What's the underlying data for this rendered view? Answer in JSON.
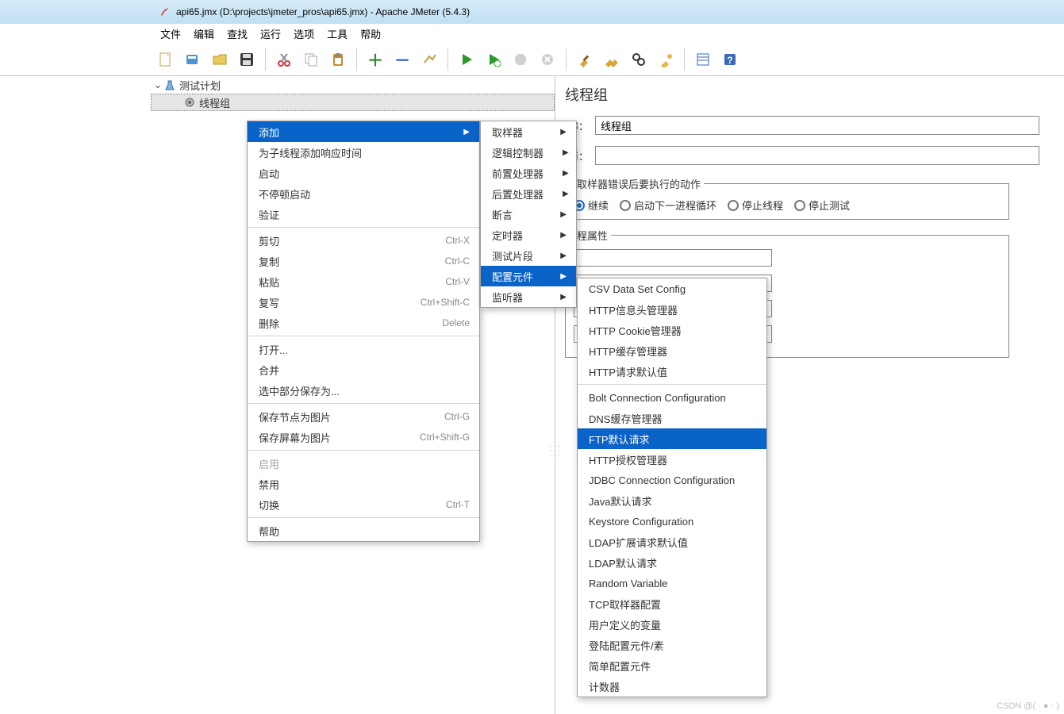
{
  "title": "api65.jmx (D:\\projects\\jmeter_pros\\api65.jmx) - Apache JMeter (5.4.3)",
  "menubar": [
    "文件",
    "编辑",
    "查找",
    "运行",
    "选项",
    "工具",
    "帮助"
  ],
  "tree": {
    "root_label": "测试计划",
    "child_label": "线程组"
  },
  "panel": {
    "heading": "线程组",
    "name_label": "称：",
    "name_value": "线程组",
    "comment_label": "释：",
    "error_legend": "取样器错误后要执行的动作",
    "props_legend": "程属性",
    "radios": [
      "继续",
      "启动下一进程循环",
      "停止线程",
      "停止测试"
    ],
    "radio_selected": 0
  },
  "menu1": [
    {
      "label": "添加",
      "hl": true,
      "arrow": true
    },
    {
      "label": "为子线程添加响应时间"
    },
    {
      "label": "启动"
    },
    {
      "label": "不停顿启动"
    },
    {
      "label": "验证"
    },
    {
      "sep": true
    },
    {
      "label": "剪切",
      "short": "Ctrl-X"
    },
    {
      "label": "复制",
      "short": "Ctrl-C"
    },
    {
      "label": "粘贴",
      "short": "Ctrl-V"
    },
    {
      "label": "复写",
      "short": "Ctrl+Shift-C"
    },
    {
      "label": "删除",
      "short": "Delete"
    },
    {
      "sep": true
    },
    {
      "label": "打开..."
    },
    {
      "label": "合并"
    },
    {
      "label": "选中部分保存为..."
    },
    {
      "sep": true
    },
    {
      "label": "保存节点为图片",
      "short": "Ctrl-G"
    },
    {
      "label": "保存屏幕为图片",
      "short": "Ctrl+Shift-G"
    },
    {
      "sep": true
    },
    {
      "label": "启用",
      "dis": true
    },
    {
      "label": "禁用"
    },
    {
      "label": "切换",
      "short": "Ctrl-T"
    },
    {
      "sep": true
    },
    {
      "label": "帮助"
    }
  ],
  "menu2": [
    {
      "label": "取样器",
      "arrow": true
    },
    {
      "label": "逻辑控制器",
      "arrow": true
    },
    {
      "label": "前置处理器",
      "arrow": true
    },
    {
      "label": "后置处理器",
      "arrow": true
    },
    {
      "label": "断言",
      "arrow": true
    },
    {
      "label": "定时器",
      "arrow": true
    },
    {
      "label": "测试片段",
      "arrow": true
    },
    {
      "label": "配置元件",
      "hl": true,
      "arrow": true
    },
    {
      "label": "监听器",
      "arrow": true
    }
  ],
  "menu3": [
    {
      "label": "CSV Data Set Config"
    },
    {
      "label": "HTTP信息头管理器"
    },
    {
      "label": "HTTP Cookie管理器"
    },
    {
      "label": "HTTP缓存管理器"
    },
    {
      "label": "HTTP请求默认值"
    },
    {
      "sep": true
    },
    {
      "label": "Bolt Connection Configuration"
    },
    {
      "label": "DNS缓存管理器"
    },
    {
      "label": "FTP默认请求",
      "hl": true
    },
    {
      "label": "HTTP授权管理器"
    },
    {
      "label": "JDBC Connection Configuration"
    },
    {
      "label": "Java默认请求"
    },
    {
      "label": "Keystore Configuration"
    },
    {
      "label": "LDAP扩展请求默认值"
    },
    {
      "label": "LDAP默认请求"
    },
    {
      "label": "Random Variable"
    },
    {
      "label": "TCP取样器配置"
    },
    {
      "label": "用户定义的变量"
    },
    {
      "label": "登陆配置元件/素"
    },
    {
      "label": "简单配置元件"
    },
    {
      "label": "计数器"
    }
  ],
  "watermark": "CSDN @( · ● · )"
}
